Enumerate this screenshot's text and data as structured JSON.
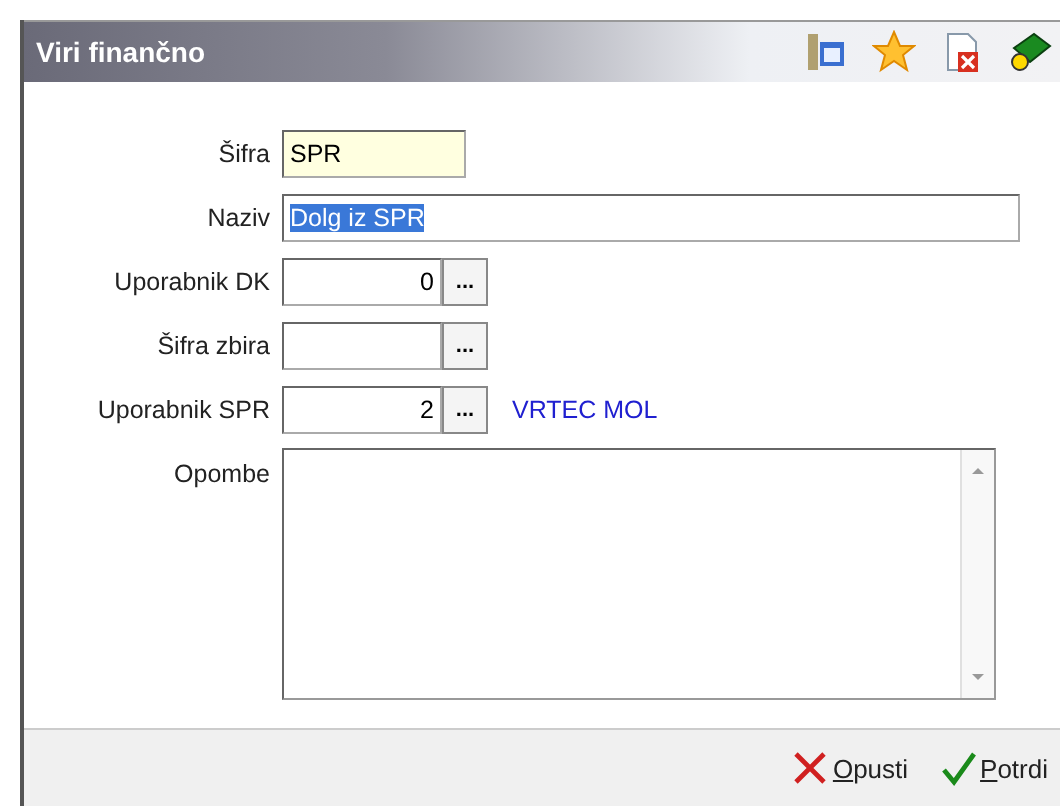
{
  "window": {
    "title": "Viri finančno"
  },
  "toolbar": [
    {
      "kind": "table"
    },
    {
      "kind": "star"
    },
    {
      "kind": "delete"
    },
    {
      "kind": "help"
    }
  ],
  "fields": [
    {
      "kind": "text",
      "label": "Šifra",
      "value": "SPR",
      "highlighted": true
    },
    {
      "kind": "selected",
      "label": "Naziv",
      "value": "Dolg iz SPR"
    },
    {
      "kind": "lookup",
      "label": "Uporabnik DK",
      "value": "0",
      "button": "..."
    },
    {
      "kind": "lookup",
      "label": "Šifra zbira",
      "button": "..."
    },
    {
      "kind": "lookup",
      "label": "Uporabnik SPR",
      "value": "2",
      "button": "...",
      "note": "VRTEC MOL"
    },
    {
      "kind": "memo",
      "label": "Opombe"
    }
  ],
  "buttons": [
    {
      "kind": "cancel",
      "label": "Opusti"
    },
    {
      "kind": "confirm",
      "label": "Potrdi"
    }
  ]
}
